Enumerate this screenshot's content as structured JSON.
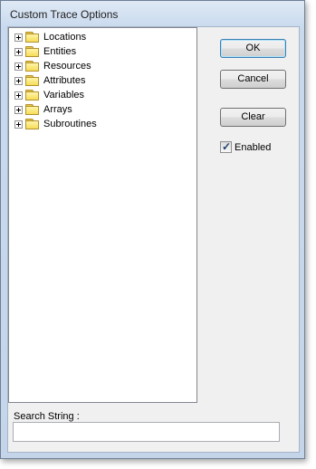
{
  "window": {
    "title": "Custom Trace Options"
  },
  "tree": {
    "items": [
      {
        "label": "Locations"
      },
      {
        "label": "Entities"
      },
      {
        "label": "Resources"
      },
      {
        "label": "Attributes"
      },
      {
        "label": "Variables"
      },
      {
        "label": "Arrays"
      },
      {
        "label": "Subroutines"
      }
    ]
  },
  "buttons": {
    "ok": "OK",
    "cancel": "Cancel",
    "clear": "Clear"
  },
  "enabled": {
    "label": "Enabled",
    "checked": true
  },
  "search": {
    "label": "Search String :",
    "value": ""
  },
  "colors": {
    "folder": "#f6dc58",
    "default_button_border": "#3c7fb1"
  },
  "icons": {
    "tree_item": "folder-icon",
    "expander": "expand-plus-icon"
  }
}
